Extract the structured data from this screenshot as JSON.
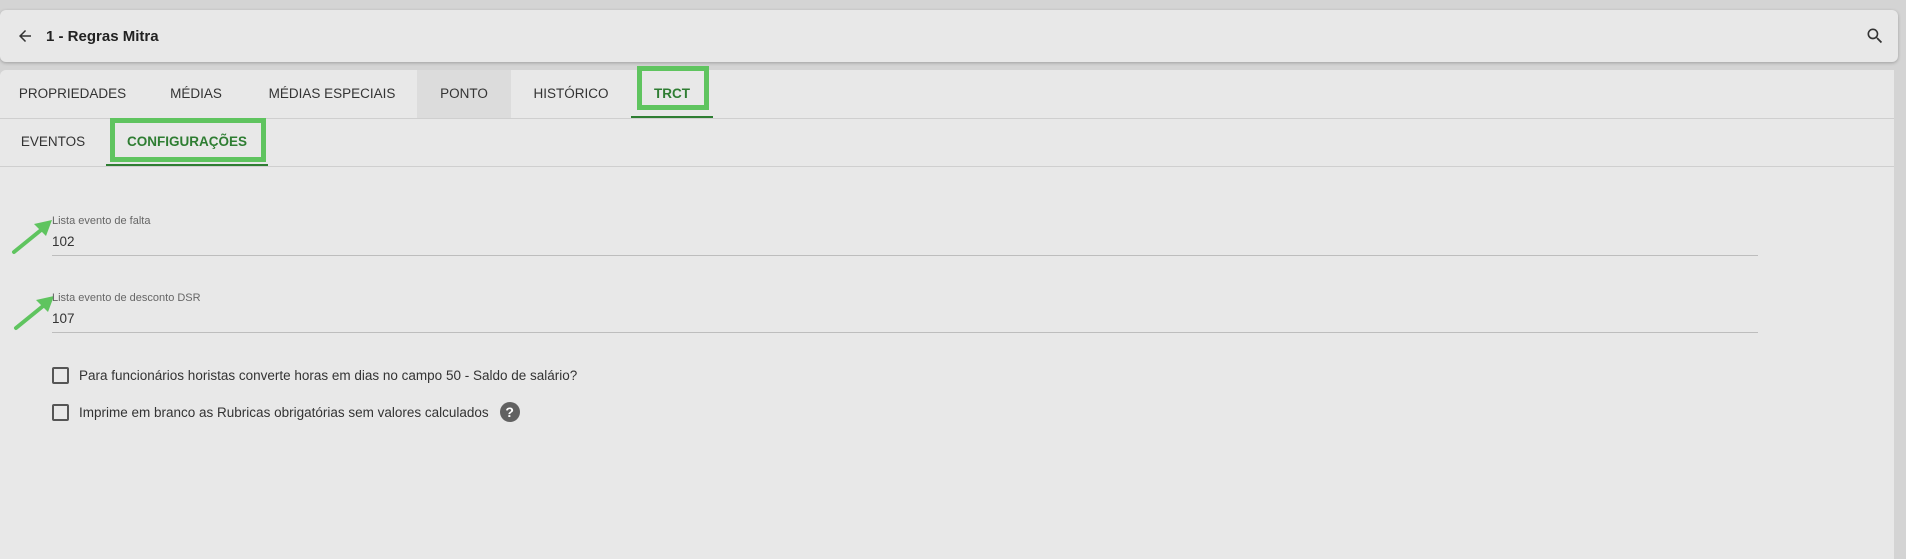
{
  "header": {
    "title": "1 - Regras Mitra",
    "back_icon": "arrow-left-icon",
    "search_icon": "search-icon"
  },
  "tabs": {
    "main": [
      {
        "label": "PROPRIEDADES"
      },
      {
        "label": "MÉDIAS"
      },
      {
        "label": "MÉDIAS ESPECIAIS"
      },
      {
        "label": "PONTO"
      },
      {
        "label": "HISTÓRICO"
      },
      {
        "label": "TRCT"
      }
    ],
    "sub": [
      {
        "label": "EVENTOS"
      },
      {
        "label": "CONFIGURAÇÕES"
      }
    ]
  },
  "form": {
    "falta": {
      "label": "Lista evento de falta",
      "value": "102"
    },
    "dsr": {
      "label": "Lista evento de desconto DSR",
      "value": "107"
    },
    "horistas": {
      "label": "Para funcionários horistas converte horas em dias no campo 50 - Saldo de salário?",
      "checked": false
    },
    "rubricas": {
      "label": "Imprime em branco as Rubricas obrigatórias sem valores calculados",
      "checked": false,
      "help_icon": "?"
    }
  },
  "colors": {
    "accent": "#2e7d32",
    "highlight": "#5fc45f"
  }
}
